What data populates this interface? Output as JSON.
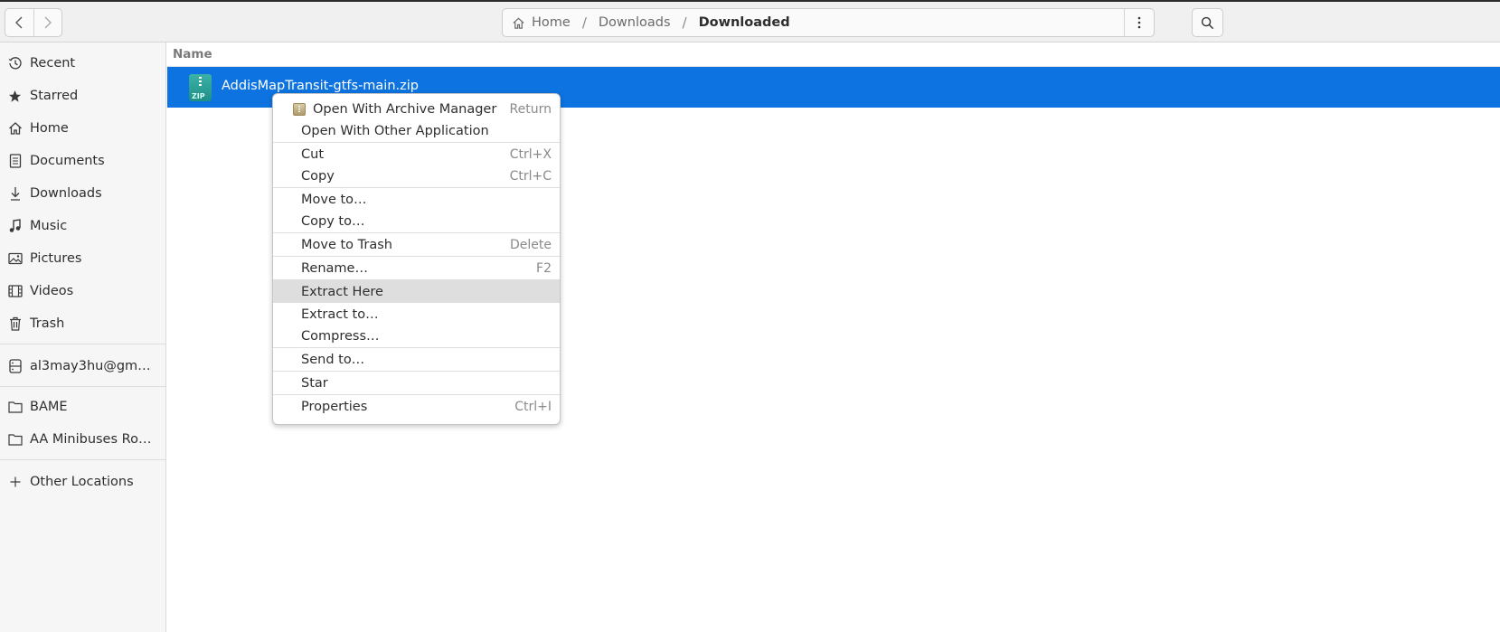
{
  "header": {
    "back_icon": "chevron-left-icon",
    "forward_icon": "chevron-right-icon",
    "breadcrumbs": [
      "Home",
      "Downloads",
      "Downloaded"
    ],
    "separator": "/",
    "menu_icon": "vertical-dots-icon",
    "search_icon": "search-icon"
  },
  "sidebar": {
    "items": [
      {
        "label": "Recent",
        "icon": "clock-icon"
      },
      {
        "label": "Starred",
        "icon": "star-icon"
      },
      {
        "label": "Home",
        "icon": "home-icon"
      },
      {
        "label": "Documents",
        "icon": "document-icon"
      },
      {
        "label": "Downloads",
        "icon": "download-icon"
      },
      {
        "label": "Music",
        "icon": "music-icon"
      },
      {
        "label": "Pictures",
        "icon": "picture-icon"
      },
      {
        "label": "Videos",
        "icon": "video-icon"
      },
      {
        "label": "Trash",
        "icon": "trash-icon"
      },
      {
        "label": "al3may3hu@gmail.com",
        "icon": "network-drive-icon"
      },
      {
        "label": "BAME",
        "icon": "folder-icon"
      },
      {
        "label": "AA Minibuses Routes",
        "icon": "folder-icon"
      },
      {
        "label": "Other Locations",
        "icon": "plus-icon"
      }
    ]
  },
  "main": {
    "column_header": "Name",
    "files": [
      {
        "name": "AddisMapTransit-gtfs-main.zip",
        "icon": "zip-archive-icon",
        "icon_text": "ZIP",
        "selected": true
      }
    ]
  },
  "context_menu": {
    "items": [
      {
        "label": "Open With Archive Manager",
        "shortcut": "Return",
        "icon": "archive-manager-icon"
      },
      {
        "label": "Open With Other Application",
        "shortcut": ""
      },
      {
        "label": "Cut",
        "shortcut": "Ctrl+X"
      },
      {
        "label": "Copy",
        "shortcut": "Ctrl+C"
      },
      {
        "label": "Move to…",
        "shortcut": ""
      },
      {
        "label": "Copy to…",
        "shortcut": ""
      },
      {
        "label": "Move to Trash",
        "shortcut": "Delete"
      },
      {
        "label": "Rename…",
        "shortcut": "F2"
      },
      {
        "label": "Extract Here",
        "shortcut": "",
        "highlighted": true
      },
      {
        "label": "Extract to…",
        "shortcut": ""
      },
      {
        "label": "Compress…",
        "shortcut": ""
      },
      {
        "label": "Send to…",
        "shortcut": ""
      },
      {
        "label": "Star",
        "shortcut": ""
      },
      {
        "label": "Properties",
        "shortcut": "Ctrl+I"
      }
    ]
  },
  "colors": {
    "selection": "#0c73e0",
    "hover": "#dedede",
    "headerbar": "#f0f0f0",
    "sidebar": "#f6f6f6"
  }
}
